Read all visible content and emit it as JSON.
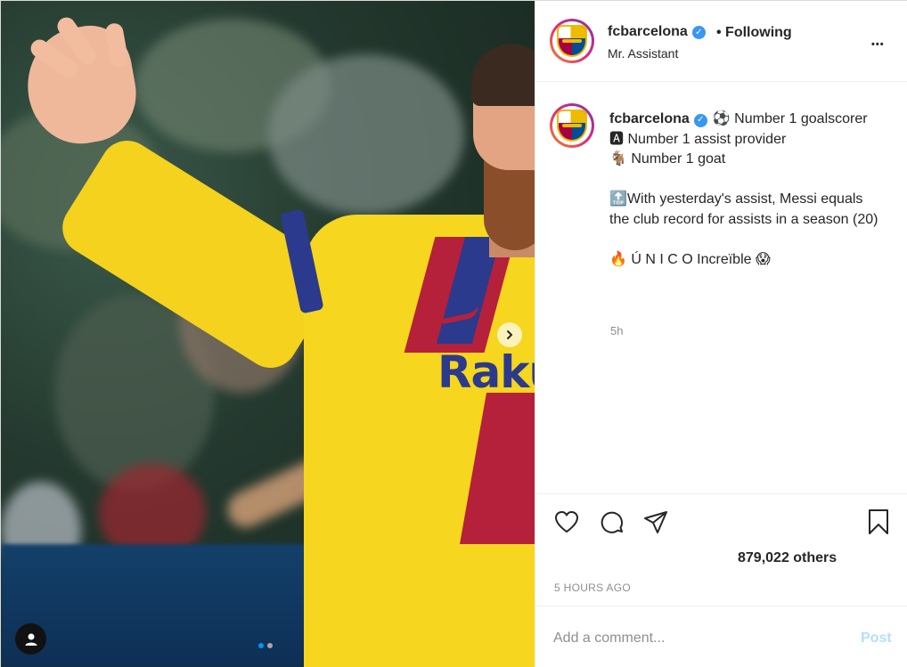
{
  "header": {
    "username": "fcbarcelona",
    "follow_state": "• Following",
    "subtitle": "Mr. Assistant",
    "more_glyph": "•••"
  },
  "caption": {
    "username": "fcbarcelona",
    "text": "⚽ Number 1 goalscorer\n🅰 Number 1 assist provider\n🐐 Number 1 goat\n\n🔝With yesterday's assist, Messi equals the club record for assists in a season (20)\n\n🔥 Ú N I C O Increïble 😱",
    "time": "5h"
  },
  "media": {
    "sponsor_text": "Rakut",
    "carousel_total": 2,
    "carousel_active": 1
  },
  "actions": {
    "likes_text": "879,022 others",
    "posted_ago": "5 HOURS AGO"
  },
  "comment": {
    "placeholder": "Add a comment...",
    "post_label": "Post"
  },
  "colors": {
    "verified": "#3897f0",
    "post_disabled": "#b2dffc",
    "active_dot": "#0095f6"
  },
  "icons": [
    "verified-badge-icon",
    "more-options-icon",
    "carousel-next-icon",
    "user-tag-icon",
    "heart-icon",
    "comment-icon",
    "share-icon",
    "bookmark-icon"
  ]
}
